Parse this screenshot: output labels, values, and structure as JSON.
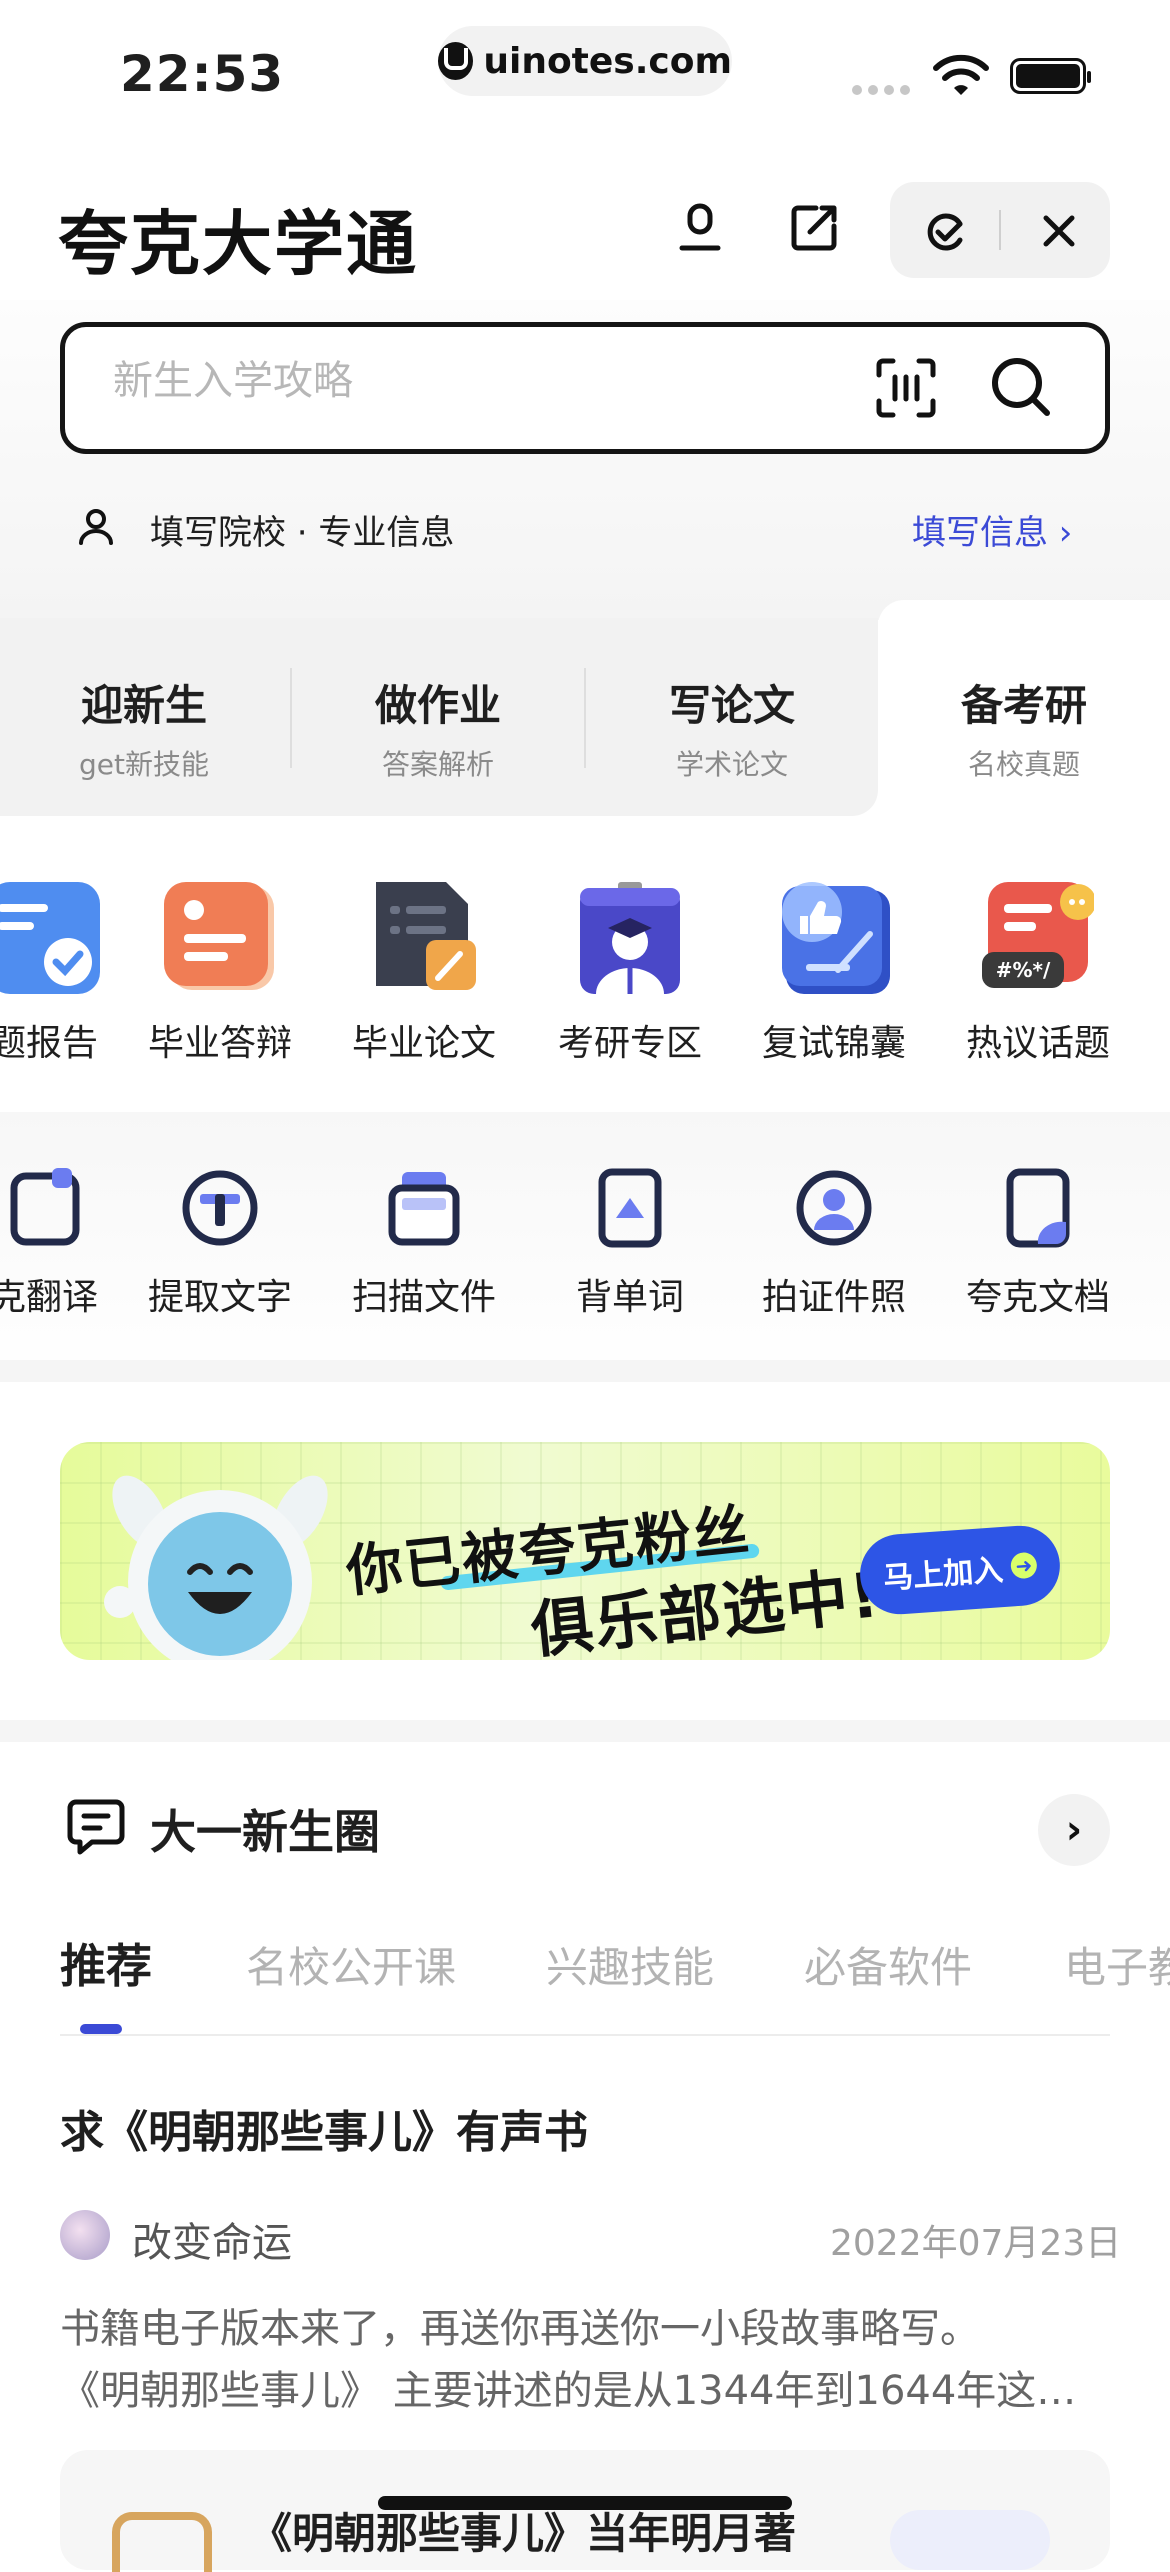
{
  "status_bar": {
    "time": "22:53",
    "url": "uinotes.com"
  },
  "header": {
    "title": "夸克大学通"
  },
  "search": {
    "placeholder": "新生入学攻略"
  },
  "school_info": {
    "label": "填写院校 · 专业信息",
    "link": "填写信息 ›"
  },
  "category_tabs": [
    {
      "title": "迎新生",
      "subtitle": "get新技能"
    },
    {
      "title": "做作业",
      "subtitle": "答案解析"
    },
    {
      "title": "写论文",
      "subtitle": "学术论文"
    },
    {
      "title": "备考研",
      "subtitle": "名校真题"
    }
  ],
  "active_category": "备考研",
  "tools": [
    {
      "label": "题报告",
      "icon": "report-icon"
    },
    {
      "label": "毕业答辩",
      "icon": "defense-icon"
    },
    {
      "label": "毕业论文",
      "icon": "thesis-icon"
    },
    {
      "label": "考研专区",
      "icon": "graduate-icon"
    },
    {
      "label": "复试锦囊",
      "icon": "tips-icon"
    },
    {
      "label": "热议话题",
      "icon": "topic-icon"
    }
  ],
  "small_tools": [
    {
      "label": "克翻译",
      "icon": "translate-icon"
    },
    {
      "label": "提取文字",
      "icon": "extract-text-icon"
    },
    {
      "label": "扫描文件",
      "icon": "scan-file-icon"
    },
    {
      "label": "背单词",
      "icon": "vocabulary-icon"
    },
    {
      "label": "拍证件照",
      "icon": "id-photo-icon"
    },
    {
      "label": "夸克文档",
      "icon": "document-icon"
    }
  ],
  "banner": {
    "line1": "你已被夸克粉丝",
    "line2": "俱乐部选中!",
    "button": "马上加入"
  },
  "circle": {
    "title": "大一新生圈",
    "tabs": [
      "推荐",
      "名校公开课",
      "兴趣技能",
      "必备软件",
      "电子教"
    ],
    "active_tab": "推荐"
  },
  "post": {
    "title": "求《明朝那些事儿》有声书",
    "author": "改变命运",
    "date": "2022年07月23日",
    "excerpt_line1": "书籍电子版本来了，再送你再送你一小段故事略写。",
    "excerpt_line2": "《明朝那些事儿》 主要讲述的是从1344年到1644年这…"
  },
  "card": {
    "title": "《明朝那些事儿》当年明月著"
  },
  "colors": {
    "accent": "#3b4ad6",
    "banner_green": "#e6fb9a",
    "banner_button": "#2d55e6"
  }
}
